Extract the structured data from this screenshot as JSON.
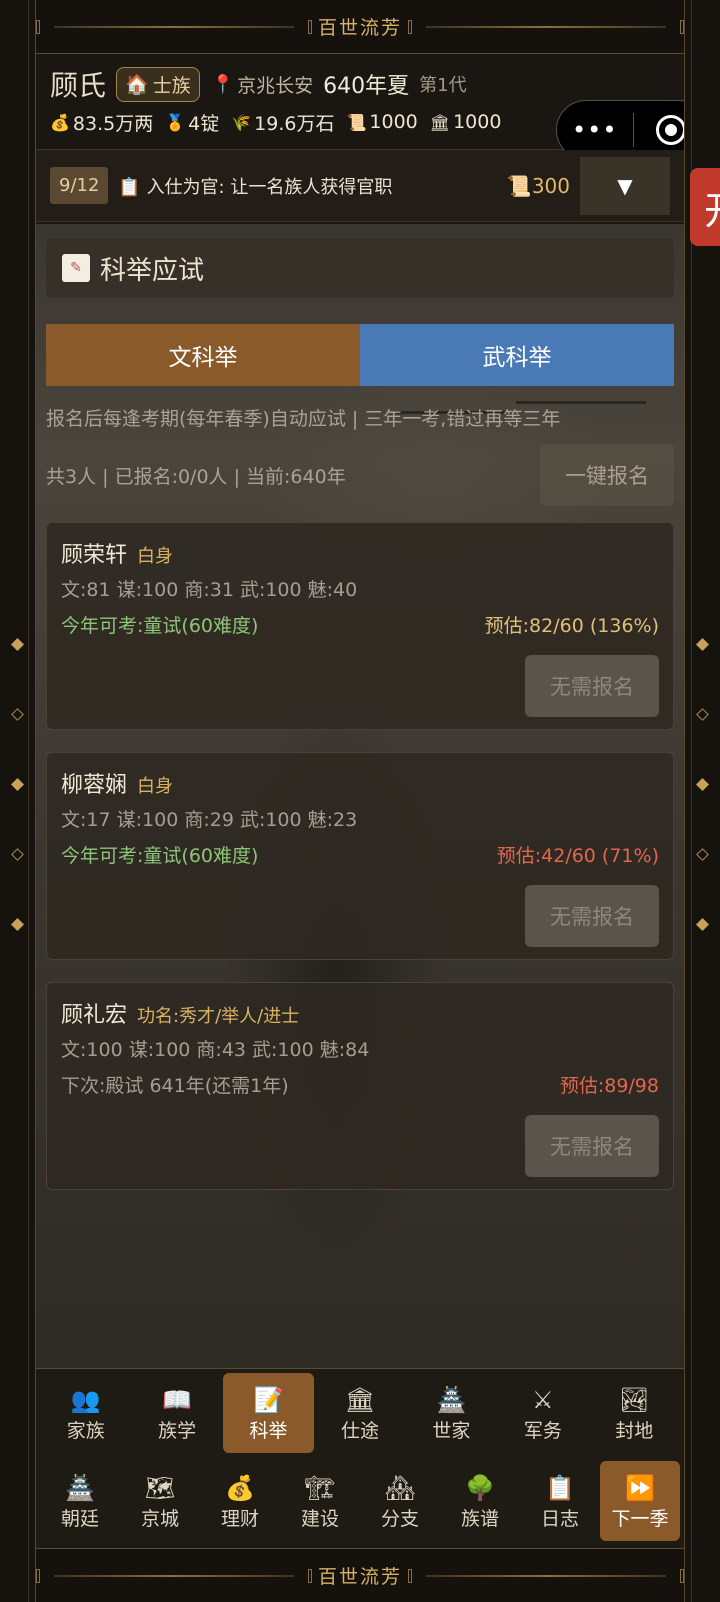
{
  "banner": {
    "title": "百世流芳"
  },
  "header": {
    "clan_name": "顾氏",
    "rank_icon": "house-icon",
    "rank": "士族",
    "location": "京兆长安",
    "year": "640年夏",
    "generation": "第1代",
    "resources": [
      {
        "icon": "money-bag-icon",
        "glyph": "💰",
        "value": "83.5万两"
      },
      {
        "icon": "medal-icon",
        "glyph": "🏅",
        "value": "4锭"
      },
      {
        "icon": "grain-icon",
        "glyph": "🌾",
        "value": "19.6万石"
      },
      {
        "icon": "scroll-icon",
        "glyph": "📜",
        "value": "1000"
      },
      {
        "icon": "temple-icon",
        "glyph": "🏛",
        "value": "1000"
      }
    ]
  },
  "capsule": {
    "more": "•••"
  },
  "quest": {
    "progress": "9/12",
    "text": "入仕为官: 让一名族人获得官职",
    "reward": "300",
    "toggle": "▼"
  },
  "side_tab": {
    "label": "开"
  },
  "section": {
    "title": "科举应试"
  },
  "tabs": [
    {
      "label": "文科举"
    },
    {
      "label": "武科举"
    }
  ],
  "hint": "报名后每逢考期(每年春季)自动应试 | 三年一考,错过再等三年",
  "summary": "共3人 | 已报名:0/0人 | 当前:640年",
  "signup_all": "一键报名",
  "members": [
    {
      "name": "顾荣轩",
      "status": "白身",
      "stats": "文:81 谋:100 商:31 武:100 魅:40",
      "exam": "今年可考:童试(60难度)",
      "estimate": "预估:82/60 (136%)",
      "button": "无需报名"
    },
    {
      "name": "柳蓉娴",
      "status": "白身",
      "stats": "文:17 谋:100 商:29 武:100 魅:23",
      "exam": "今年可考:童试(60难度)",
      "estimate": "预估:42/60 (71%)",
      "button": "无需报名"
    },
    {
      "name": "顾礼宏",
      "status": "功名:秀才/举人/进士",
      "stats": "文:100 谋:100 商:43 武:100 魅:84",
      "exam": "下次:殿试 641年(还需1年)",
      "estimate": "预估:89/98",
      "button": "无需报名"
    }
  ],
  "nav_row1": [
    {
      "label": "家族",
      "glyph": "👥",
      "icon": "family-icon"
    },
    {
      "label": "族学",
      "glyph": "📖",
      "icon": "book-icon"
    },
    {
      "label": "科举",
      "glyph": "📝",
      "icon": "memo-icon",
      "active": true
    },
    {
      "label": "仕途",
      "glyph": "🏛",
      "icon": "government-icon"
    },
    {
      "label": "世家",
      "glyph": "🏯",
      "icon": "castle-icon"
    },
    {
      "label": "军务",
      "glyph": "⚔",
      "icon": "swords-icon"
    },
    {
      "label": "封地",
      "glyph": "🏞",
      "icon": "landscape-icon"
    }
  ],
  "nav_row2": [
    {
      "label": "朝廷",
      "glyph": "🏯",
      "icon": "court-icon"
    },
    {
      "label": "京城",
      "glyph": "🗺",
      "icon": "map-icon"
    },
    {
      "label": "理财",
      "glyph": "💰",
      "icon": "money-bag-icon"
    },
    {
      "label": "建设",
      "glyph": "🏗",
      "icon": "construction-icon"
    },
    {
      "label": "分支",
      "glyph": "🏘",
      "icon": "houses-icon"
    },
    {
      "label": "族谱",
      "glyph": "🌳",
      "icon": "tree-icon"
    },
    {
      "label": "日志",
      "glyph": "📋",
      "icon": "clipboard-icon"
    },
    {
      "label": "下一季",
      "glyph": "⏩",
      "icon": "fast-forward-icon",
      "next": true
    }
  ]
}
